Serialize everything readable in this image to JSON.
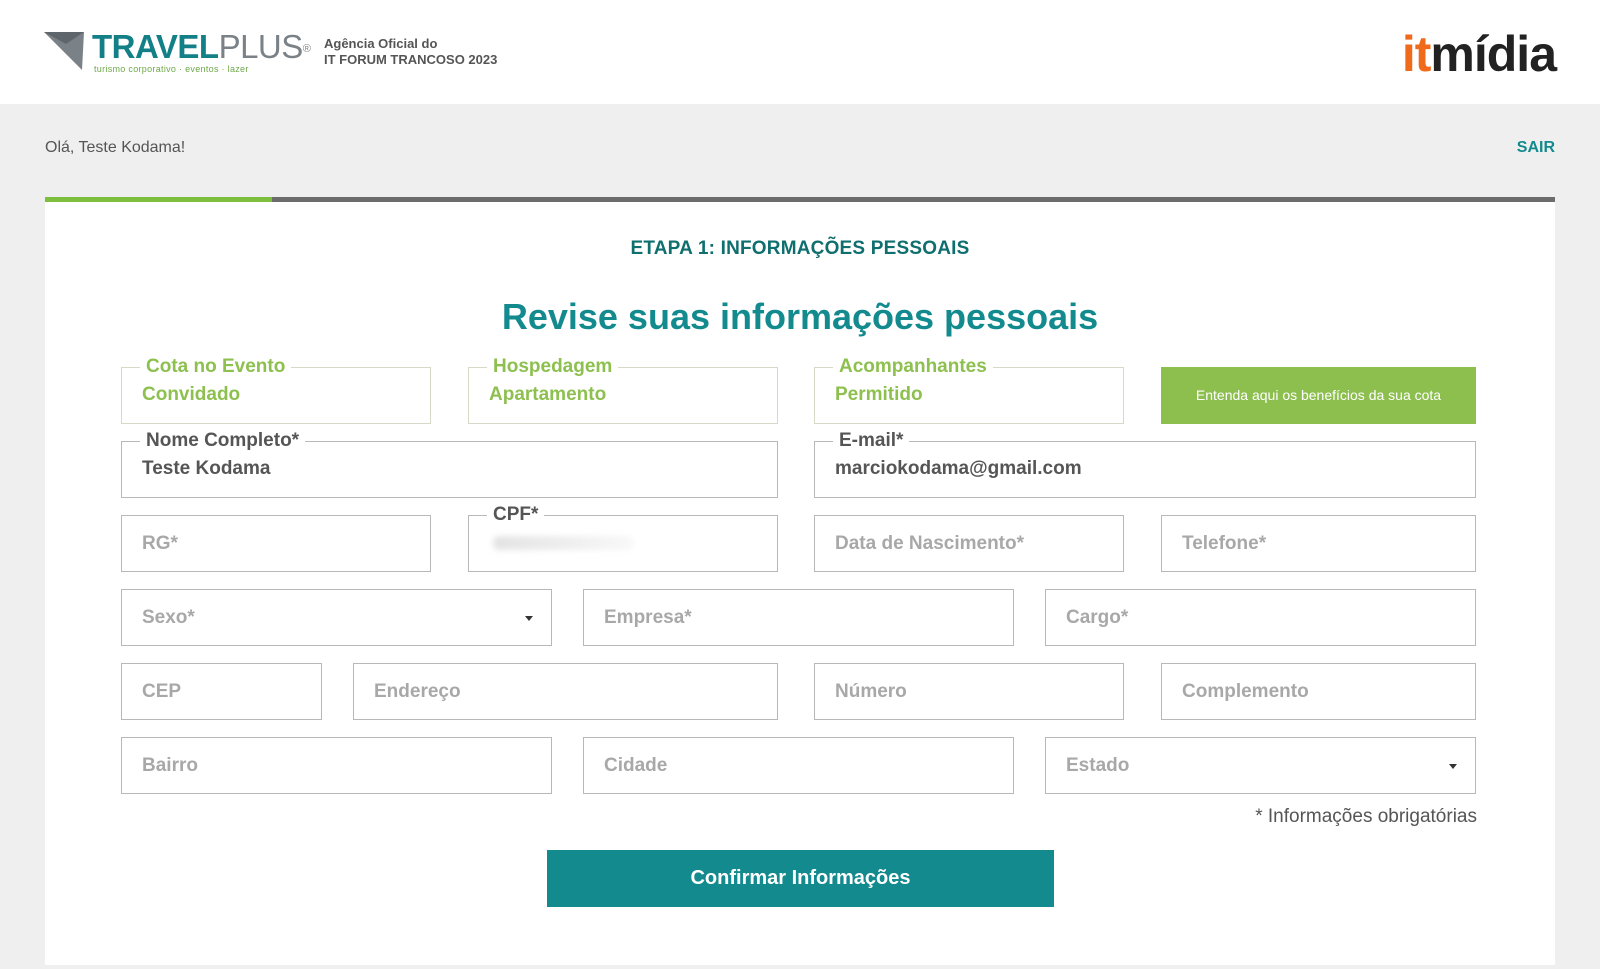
{
  "header": {
    "brand_name": "TRAVEL",
    "brand_name_plus": "PLUS",
    "brand_registered": "®",
    "brand_tagline": "turismo corporativo  ·  eventos  ·  lazer",
    "agency_line1": "Agência Oficial do",
    "agency_line2": "IT FORUM TRANCOSO 2023",
    "partner_logo_it": "it",
    "partner_logo_midia": "mídia"
  },
  "user_bar": {
    "greeting": "Olá, Teste Kodama!",
    "logout_label": "SAIR"
  },
  "progress": {
    "fraction": 0.15
  },
  "form": {
    "step_title": "ETAPA 1: INFORMAÇÕES PESSOAIS",
    "title": "Revise suas informações pessoais",
    "quota": {
      "label": "Cota no Evento",
      "value": "Convidado"
    },
    "lodging": {
      "label": "Hospedagem",
      "value": "Apartamento"
    },
    "companions": {
      "label": "Acompanhantes",
      "value": "Permitido"
    },
    "benefits_button": "Entenda aqui os benefícios da sua cota",
    "full_name": {
      "label": "Nome Completo*",
      "value": "Teste Kodama"
    },
    "email": {
      "label": "E-mail*",
      "value": "marciokodama@gmail.com"
    },
    "rg": {
      "placeholder": "RG*"
    },
    "cpf": {
      "label": "CPF*"
    },
    "birth_date": {
      "placeholder": "Data de Nascimento*"
    },
    "phone": {
      "placeholder": "Telefone*"
    },
    "gender": {
      "placeholder": "Sexo*"
    },
    "company": {
      "placeholder": "Empresa*"
    },
    "job_title": {
      "placeholder": "Cargo*"
    },
    "cep": {
      "placeholder": "CEP"
    },
    "address": {
      "placeholder": "Endereço"
    },
    "number": {
      "placeholder": "Número"
    },
    "complement": {
      "placeholder": "Complemento"
    },
    "district": {
      "placeholder": "Bairro"
    },
    "city": {
      "placeholder": "Cidade"
    },
    "state": {
      "placeholder": "Estado"
    },
    "required_note": "* Informações obrigatórias",
    "confirm_button": "Confirmar Informações"
  },
  "colors": {
    "teal": "#138a8e",
    "green": "#8dbf4f",
    "orange": "#ef6a1b"
  }
}
